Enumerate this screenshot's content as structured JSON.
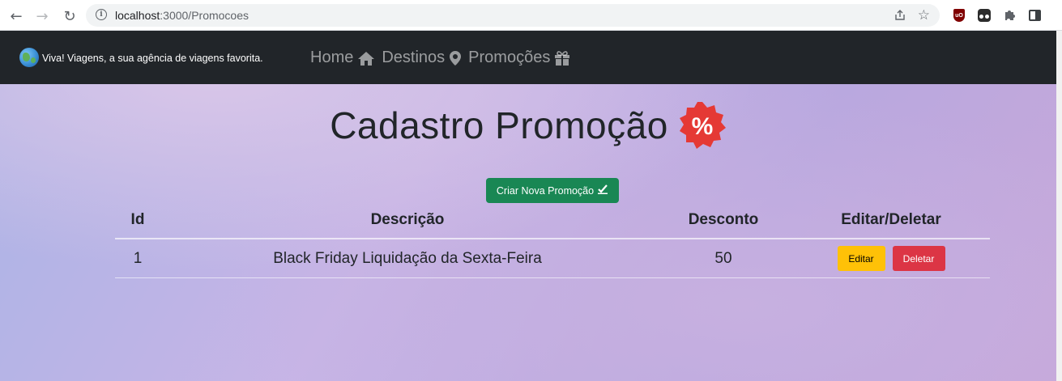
{
  "browser": {
    "url_host": "localhost",
    "url_path": ":3000/Promocoes"
  },
  "navbar": {
    "brand": "Viva! Viagens, a sua agência de viagens favorita.",
    "links": [
      {
        "label": "Home",
        "icon": "home-icon"
      },
      {
        "label": "Destinos",
        "icon": "map-pin-icon"
      },
      {
        "label": "Promoções",
        "icon": "gift-icon"
      }
    ]
  },
  "main": {
    "title": "Cadastro Promoção",
    "title_icon": "percent-badge-icon",
    "create_button": "Criar Nova Promoção",
    "table": {
      "columns": [
        "Id",
        "Descrição",
        "Desconto",
        "Editar/Deletar"
      ],
      "rows": [
        {
          "id": "1",
          "descricao": "Black Friday Liquidação da Sexta-Feira",
          "desconto": "50",
          "edit_label": "Editar",
          "delete_label": "Deletar"
        }
      ]
    }
  },
  "colors": {
    "navbar_bg": "#212529",
    "create_button": "#198754",
    "edit_button": "#ffc107",
    "delete_button": "#dc3545",
    "percent_badge": "#e53935"
  }
}
